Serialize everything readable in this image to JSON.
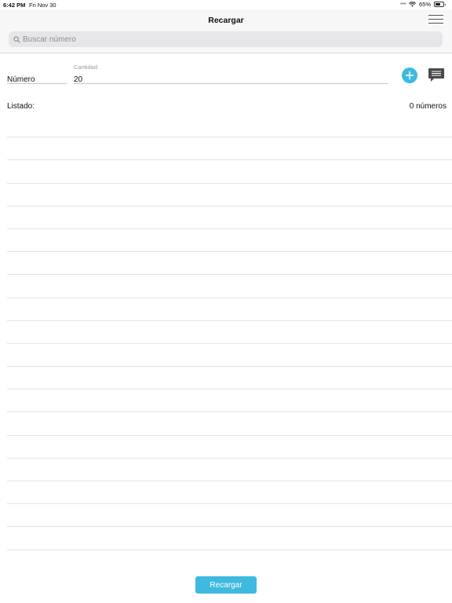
{
  "status_bar": {
    "time": "6:42 PM",
    "date": "Fri Nov 30",
    "battery": "65%",
    "battery_level": 0.65
  },
  "nav": {
    "title": "Recargar",
    "menu_icon": "hamburger-icon"
  },
  "search": {
    "placeholder": "Buscar número",
    "value": "",
    "icon": "search-icon"
  },
  "form": {
    "numero_placeholder": "Número",
    "numero_value": "",
    "cantidad_label": "Cantidad",
    "cantidad_value": "20",
    "add_icon": "plus-icon",
    "message_icon": "message-icon"
  },
  "listado": {
    "label": "Listado:",
    "count": "0 números",
    "rows": []
  },
  "footer": {
    "recargar_label": "Recargar"
  },
  "colors": {
    "accent": "#3fb9df",
    "nav_background": "#f7f7f7",
    "search_background": "#e6e6e9"
  }
}
